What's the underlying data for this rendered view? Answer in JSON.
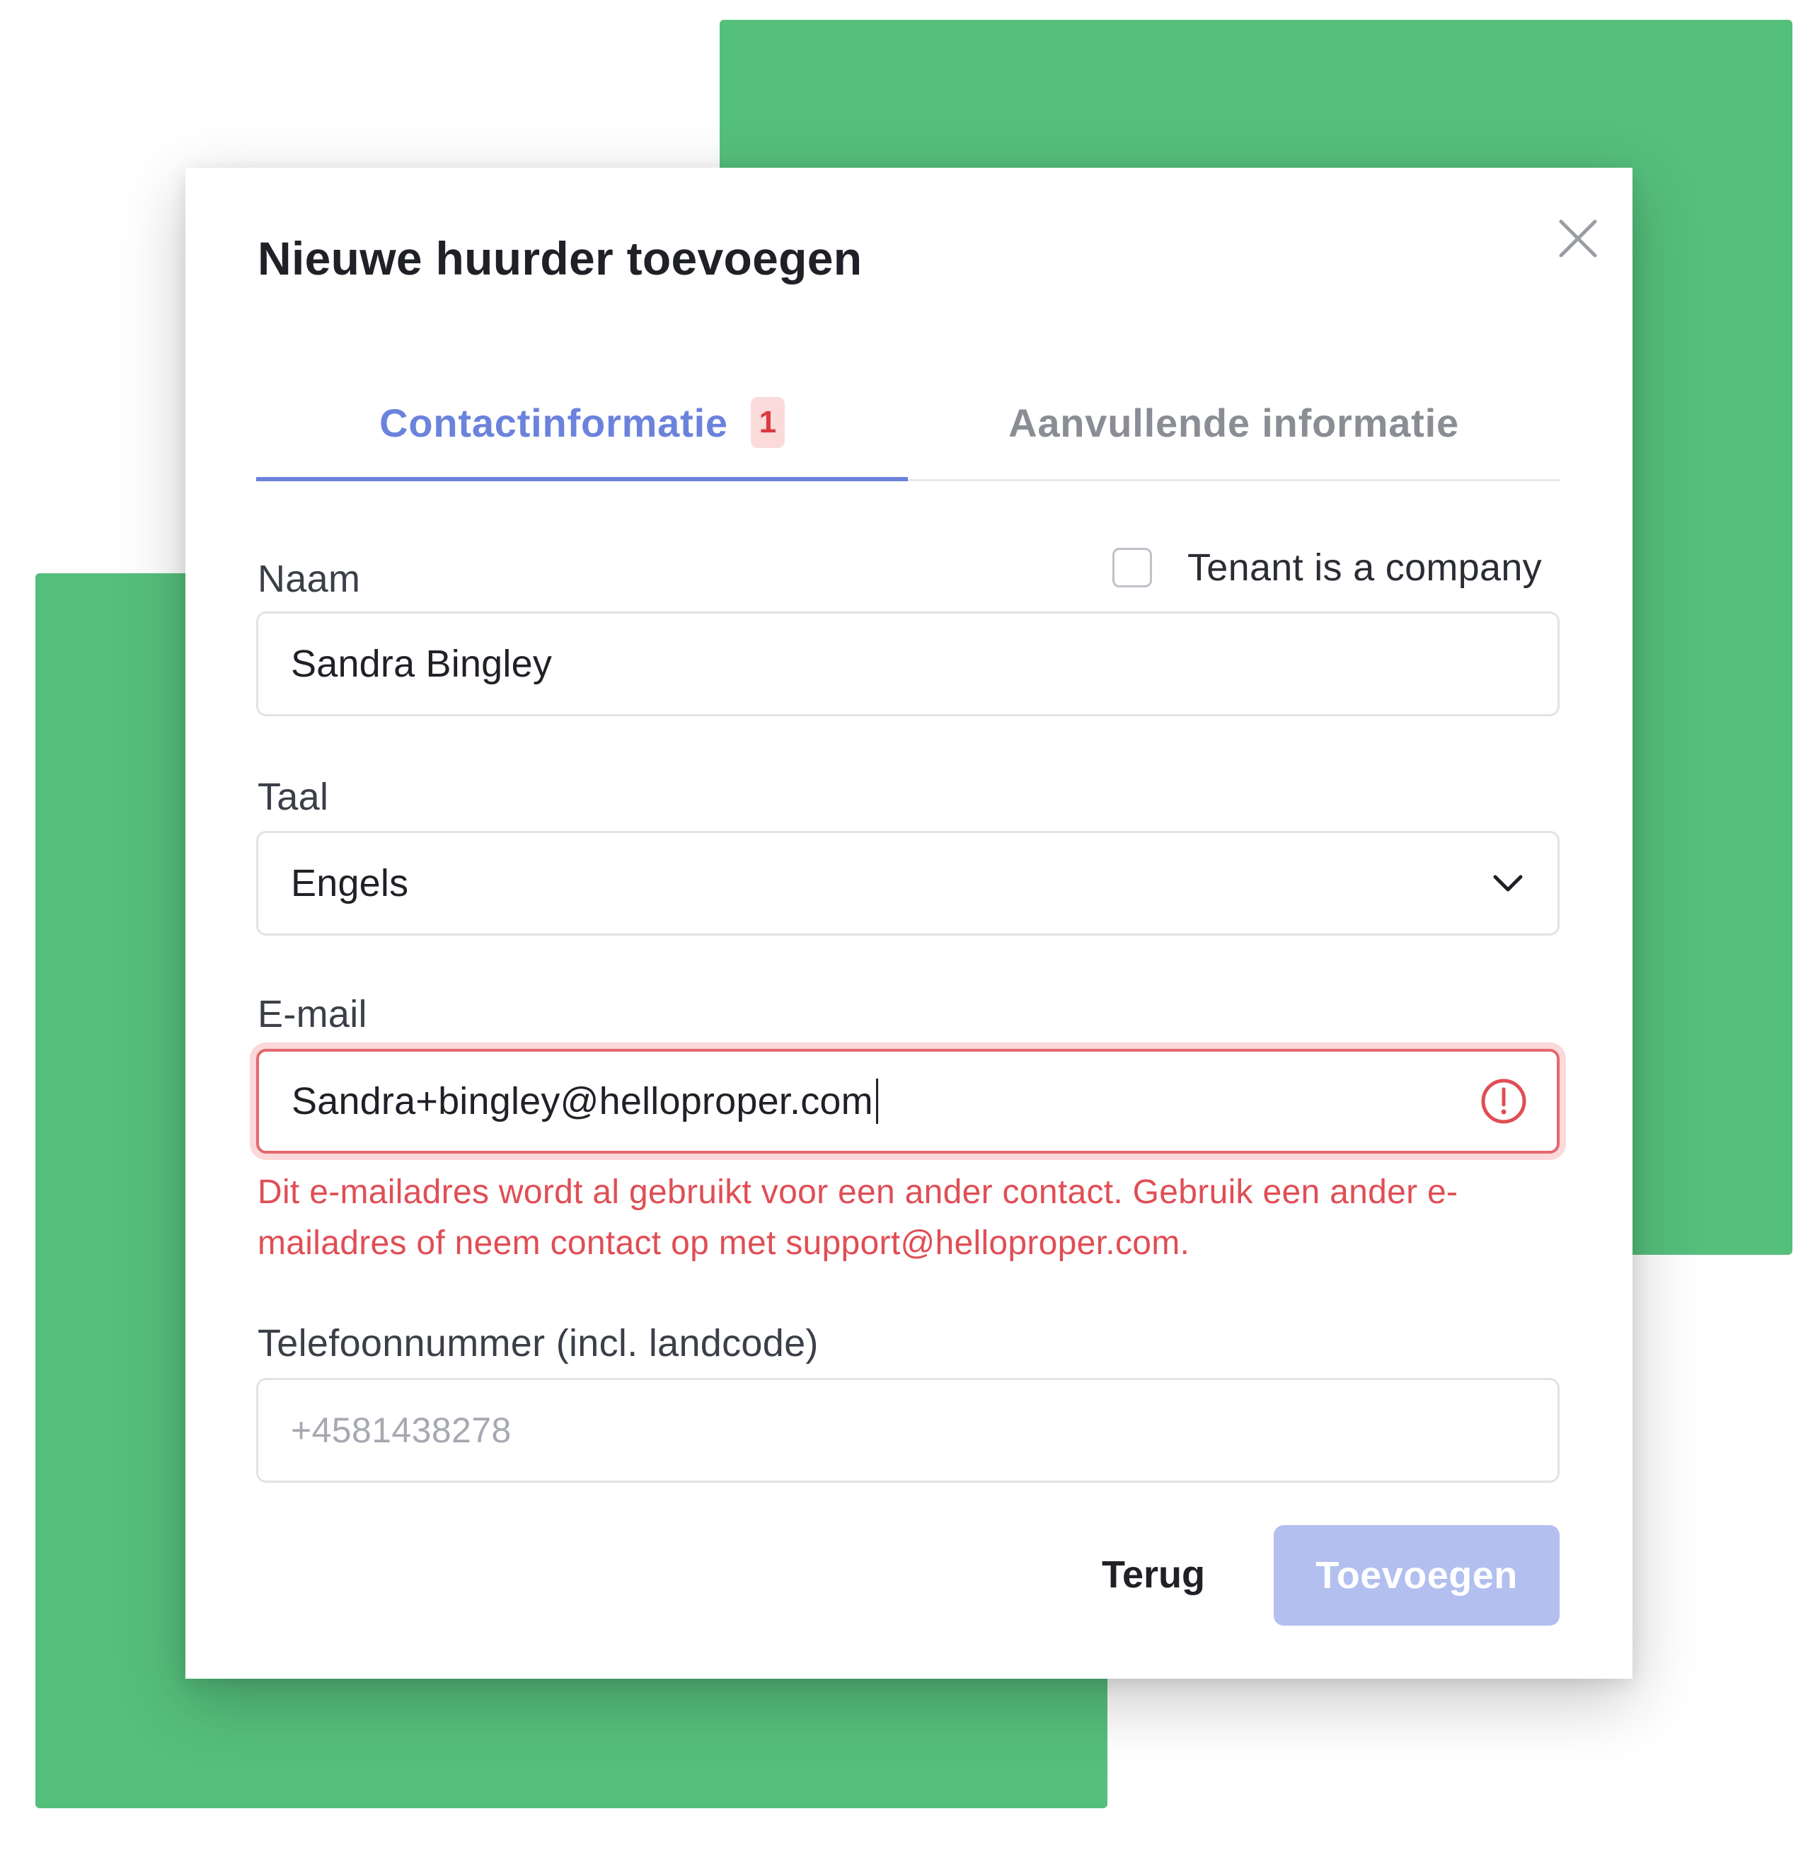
{
  "colors": {
    "background_green": "#55bf7c",
    "accent_blue": "#6b83dc",
    "tab_inactive": "#8a8d94",
    "badge_bg": "#fbdada",
    "badge_text": "#d9393f",
    "error_red": "#e04e55",
    "primary_disabled": "#b2bfef"
  },
  "modal": {
    "title": "Nieuwe huurder toevoegen",
    "close_icon": "close-icon"
  },
  "tabs": [
    {
      "label": "Contactinformatie",
      "badge": "1",
      "active": true
    },
    {
      "label": "Aanvullende informatie",
      "active": false
    }
  ],
  "form": {
    "name": {
      "label": "Naam",
      "value": "Sandra Bingley"
    },
    "company_checkbox": {
      "label": "Tenant is a company",
      "checked": false
    },
    "language": {
      "label": "Taal",
      "value": "Engels",
      "icon": "chevron-down-icon"
    },
    "email": {
      "label": "E-mail",
      "value": "Sandra+bingley@helloproper.com",
      "icon": "error-circle-icon",
      "error": "Dit e-mailadres wordt al gebruikt voor een ander contact. Gebruik een ander e-mailadres of neem contact op met support@helloproper.com."
    },
    "phone": {
      "label": "Telefoonnummer (incl. landcode)",
      "placeholder": "+4581438278"
    }
  },
  "buttons": {
    "back": "Terug",
    "add": "Toevoegen"
  }
}
